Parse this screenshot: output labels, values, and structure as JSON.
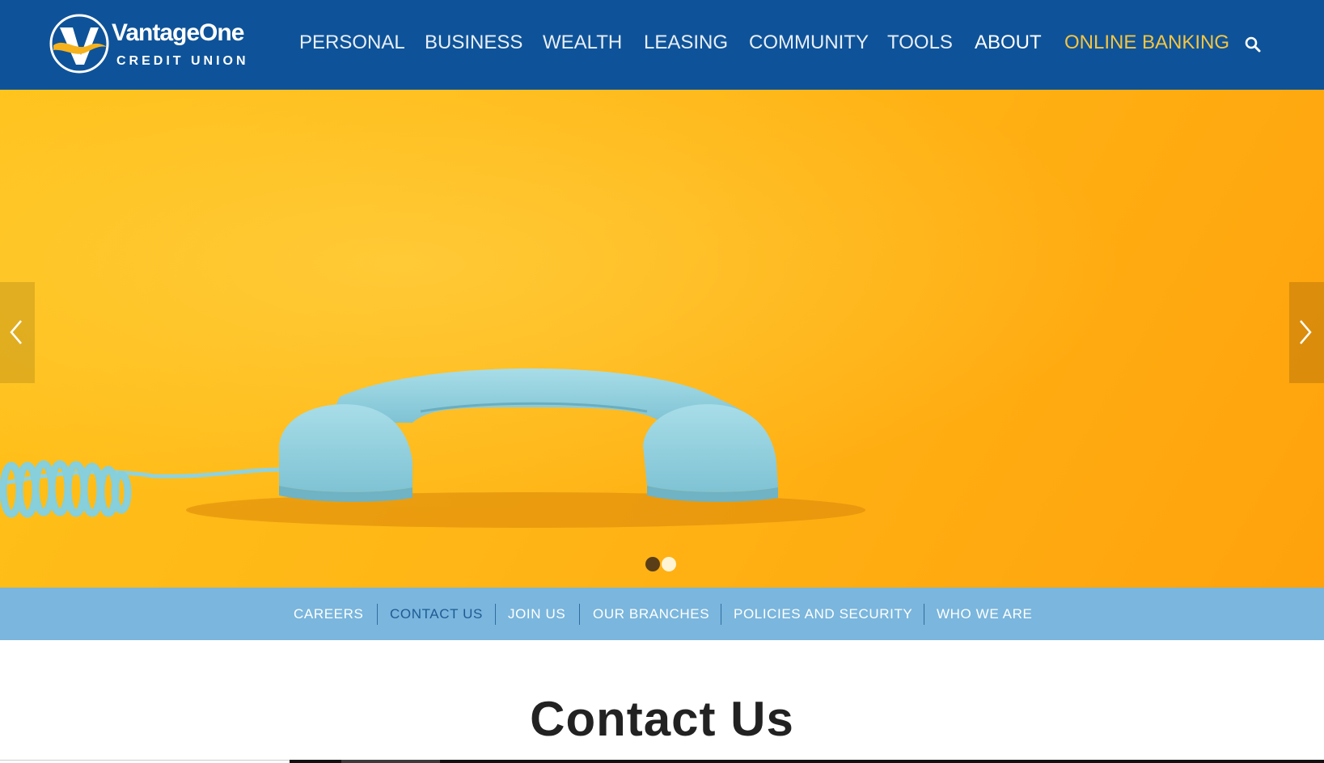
{
  "brand": {
    "name": "VantageOne",
    "tagline": "CREDIT UNION"
  },
  "nav": {
    "personal": "PERSONAL",
    "business": "BUSINESS",
    "wealth": "WEALTH",
    "leasing": "LEASING",
    "community": "COMMUNITY",
    "tools": "TOOLS",
    "about": "ABOUT",
    "online_banking": "ONLINE BANKING",
    "search_icon": "search-icon"
  },
  "hero": {
    "image": "teal retro telephone handset on yellow-orange background",
    "slides_total": 2,
    "active_slide": 1
  },
  "subnav": {
    "careers": "CAREERS",
    "contact_us": "CONTACT US",
    "join_us": "JOIN US",
    "our_branches": "OUR BRANCHES",
    "policies": "POLICIES AND SECURITY",
    "who_we_are": "WHO WE ARE"
  },
  "page": {
    "title": "Contact Us"
  },
  "colors": {
    "header": "#0e5399",
    "online_banking": "#f5c542",
    "subnav": "#7ab6dd",
    "hero": "#ffb616"
  }
}
